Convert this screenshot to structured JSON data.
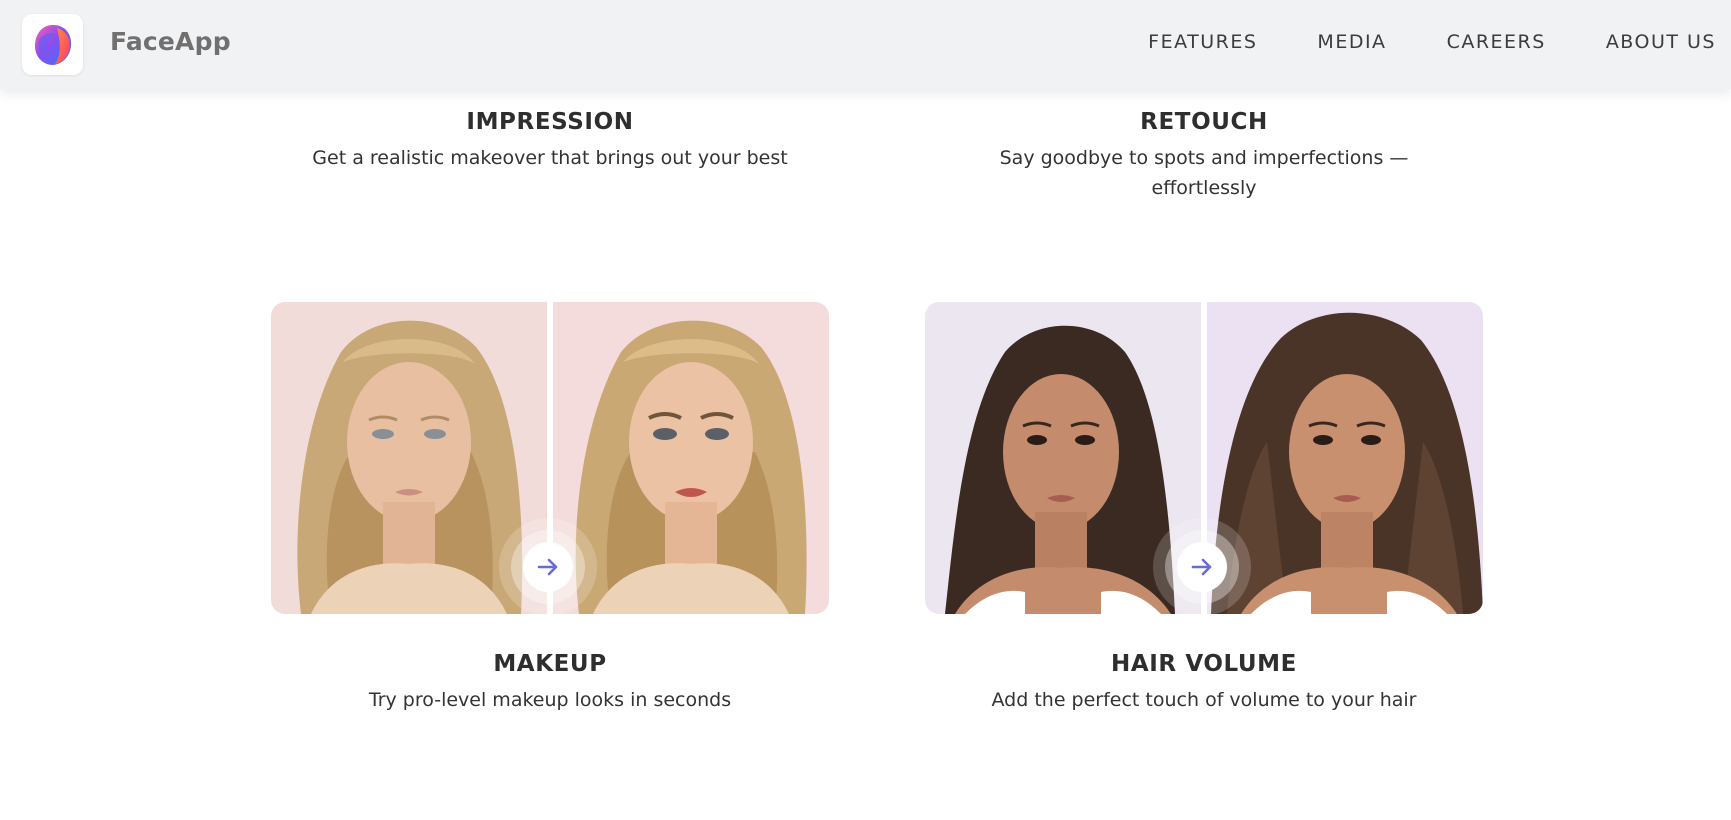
{
  "header": {
    "brand": "FaceApp",
    "logo_icon": "faceapp-logo-icon",
    "nav": [
      "FEATURES",
      "MEDIA",
      "CAREERS",
      "ABOUT US"
    ]
  },
  "features": {
    "impression": {
      "title": "IMPRESSION",
      "desc": "Get a realistic makeover that brings out your best"
    },
    "retouch": {
      "title": "RETOUCH",
      "desc": "Say goodbye to spots and imperfections — effortlessly"
    },
    "makeup": {
      "title": "MAKEUP",
      "desc": "Try pro-level makeup looks in seconds"
    },
    "hair_volume": {
      "title": "HAIR VOLUME",
      "desc": "Add the perfect touch of volume to your hair"
    }
  },
  "cards": {
    "makeup": {
      "before_alt": "Blonde woman without makeup",
      "after_alt": "Blonde woman with makeup",
      "arrow_icon": "arrow-right-icon"
    },
    "hair_volume": {
      "before_alt": "Brunette woman with flat hair",
      "after_alt": "Brunette woman with voluminous hair",
      "arrow_icon": "arrow-right-icon"
    }
  },
  "colors": {
    "header_bg": "#f1f2f4",
    "accent_arrow": "#6a6ad6"
  }
}
